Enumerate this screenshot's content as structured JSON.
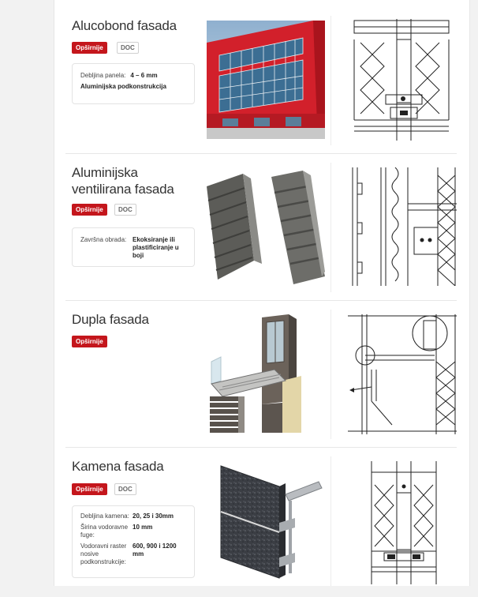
{
  "products": [
    {
      "title": "Alucobond fasada",
      "more_label": "Opširnije",
      "doc_label": "DOC",
      "specs": [
        {
          "label": "Debljina panela:",
          "value": "4 – 6 mm"
        },
        {
          "label": "",
          "value": "Aluminijska podkonstrukcija"
        }
      ]
    },
    {
      "title": "Aluminijska ventilirana fasada",
      "more_label": "Opširnije",
      "doc_label": "DOC",
      "specs": [
        {
          "label": "Završna obrada:",
          "value": "Ekoksiranje ili plastificiranje u boji"
        }
      ]
    },
    {
      "title": "Dupla fasada",
      "more_label": "Opširnije"
    },
    {
      "title": "Kamena fasada",
      "more_label": "Opširnije",
      "doc_label": "DOC",
      "specs": [
        {
          "label": "Debljina kamena:",
          "value": "20, 25 i 30mm"
        },
        {
          "label": "Širina vodoravne fuge:",
          "value": "10 mm"
        },
        {
          "label": "Vodoravni raster nosive podkonstrukcije:",
          "value": "600, 900 i 1200 mm"
        }
      ]
    }
  ],
  "colors": {
    "accent": "#c4161c",
    "facade_red": "#d2202b"
  }
}
